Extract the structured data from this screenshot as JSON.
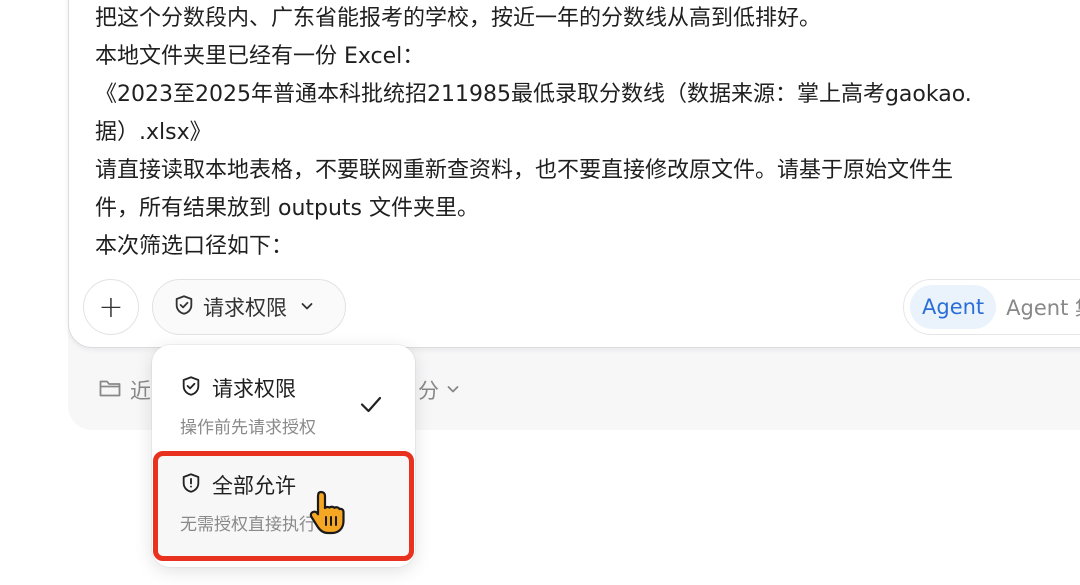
{
  "prompt": {
    "lines": [
      "把这个分数段内、广东省能报考的学校，按近一年的分数线从高到低排好。",
      "本地文件夹里已经有一份 Excel：",
      "《2023至2025年普通本科批统招211985最低录取分数线（数据来源：掌上高考gaokao.",
      "据）.xlsx》",
      "请直接读取本地表格，不要联网重新查资料，也不要直接修改原文件。请基于原始文件生",
      "件，所有结果放到 outputs 文件夹里。",
      "本次筛选口径如下："
    ]
  },
  "toolbar": {
    "plus_label": "+",
    "permission_label": "请求权限",
    "mode_active": "Agent",
    "mode_other": "Agent 集"
  },
  "under_bar": {
    "left_label": "近",
    "right_label": "分"
  },
  "dropdown": {
    "options": [
      {
        "title": "请求权限",
        "desc": "操作前先请求授权",
        "selected": true,
        "icon": "shield-check-icon"
      },
      {
        "title": "全部允许",
        "desc": "无需授权直接执行",
        "selected": false,
        "icon": "shield-alert-icon"
      }
    ]
  },
  "colors": {
    "accent": "#2b6fd6",
    "highlight_border": "#e8321f",
    "cursor_fill": "#f5a623"
  }
}
